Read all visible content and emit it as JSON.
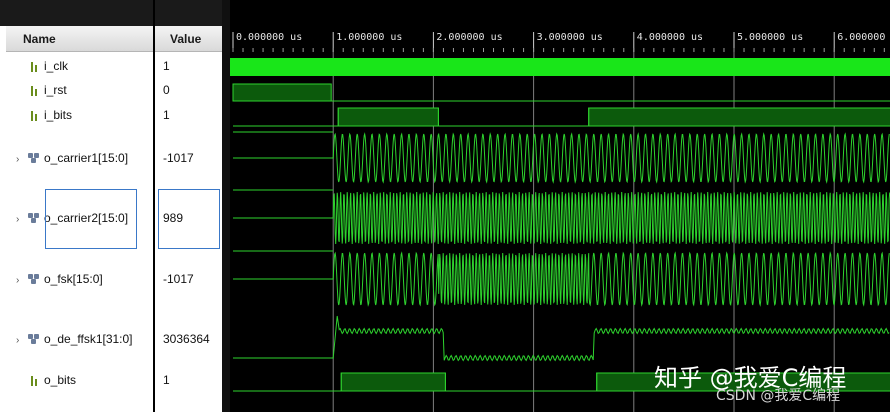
{
  "columns": {
    "name": "Name",
    "value": "Value"
  },
  "signals": [
    {
      "name": "i_clk",
      "value": "1",
      "icon": "bit-icon",
      "expand": false
    },
    {
      "name": "i_rst",
      "value": "0",
      "icon": "bit-icon",
      "expand": false
    },
    {
      "name": "i_bits",
      "value": "1",
      "icon": "bit-icon",
      "expand": false
    },
    {
      "name": "o_carrier1[15:0]",
      "value": "-1017",
      "icon": "bus-icon",
      "expand": true
    },
    {
      "name": "o_carrier2[15:0]",
      "value": "989",
      "icon": "bus-icon",
      "expand": true
    },
    {
      "name": "o_fsk[15:0]",
      "value": "-1017",
      "icon": "bus-icon",
      "expand": true
    },
    {
      "name": "o_de_ffsk1[31:0]",
      "value": "3036364",
      "icon": "bus-icon",
      "expand": true
    },
    {
      "name": "o_bits",
      "value": "1",
      "icon": "bit-icon",
      "expand": false
    }
  ],
  "timeline": {
    "ticks": [
      "0.000000 us",
      "1.000000 us",
      "2.000000 us",
      "3.000000 us",
      "4.000000 us",
      "5.000000 us",
      "6.000000"
    ]
  },
  "watermark": {
    "main": "知乎 @我爱C编程",
    "sub": "CSDN @我爱C编程"
  },
  "colors": {
    "wave": "#2ed32e",
    "wave_fill": "#0c5a0c",
    "clock": "#19e619",
    "cursor": "#e8e8e8",
    "background": "#000000"
  }
}
